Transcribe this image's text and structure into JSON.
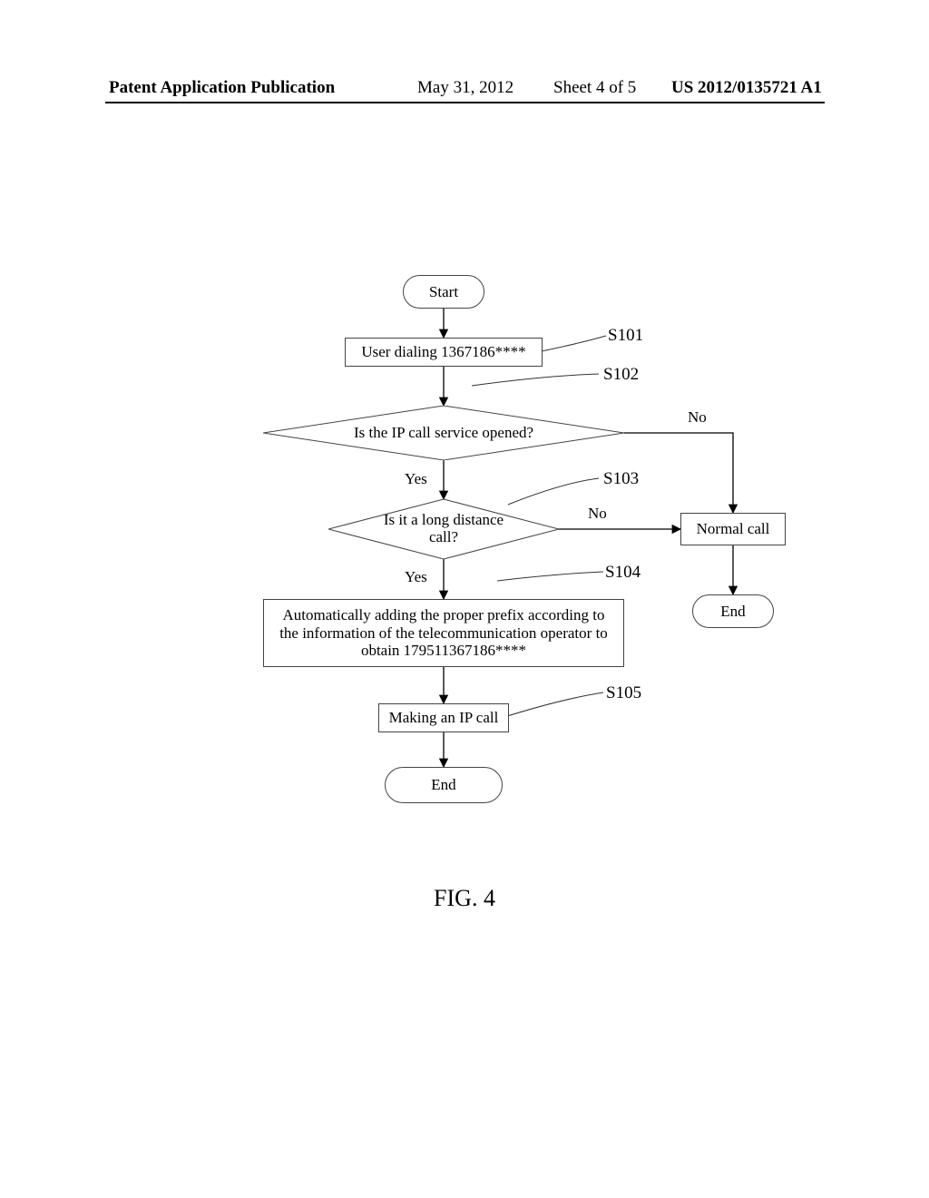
{
  "header": {
    "publication_label": "Patent Application Publication",
    "date": "May 31, 2012",
    "sheet": "Sheet 4 of 5",
    "pub_number": "US 2012/0135721 A1"
  },
  "figure_caption": "FIG. 4",
  "steps": {
    "s101": "S101",
    "s102": "S102",
    "s103": "S103",
    "s104": "S104",
    "s105": "S105"
  },
  "nodes": {
    "start": "Start",
    "user_dialing": "User dialing 1367186****",
    "ip_opened": "Is the IP call service opened?",
    "long_distance": "Is it a long distance\ncall?",
    "add_prefix": "Automatically adding the proper prefix according to the information of the telecommunication operator to obtain 179511367186****",
    "make_ip_call": "Making an IP call",
    "normal_call": "Normal call",
    "end_l": "End",
    "end_r": "End"
  },
  "edges": {
    "yes": "Yes",
    "no": "No"
  },
  "chart_data": {
    "type": "flowchart",
    "title": "FIG. 4",
    "nodes": [
      {
        "id": "start",
        "type": "terminator",
        "label": "Start"
      },
      {
        "id": "user_dialing",
        "type": "process",
        "label": "User dialing 1367186****",
        "step": "S101"
      },
      {
        "id": "ip_opened",
        "type": "decision",
        "label": "Is the IP call service opened?",
        "step": "S102"
      },
      {
        "id": "long_distance",
        "type": "decision",
        "label": "Is it a long distance call?",
        "step": "S103"
      },
      {
        "id": "add_prefix",
        "type": "process",
        "label": "Automatically adding the proper prefix according to the information of the telecommunication operator to obtain 179511367186****",
        "step": "S104"
      },
      {
        "id": "make_ip_call",
        "type": "process",
        "label": "Making an IP call",
        "step": "S105"
      },
      {
        "id": "normal_call",
        "type": "process",
        "label": "Normal call"
      },
      {
        "id": "end_l",
        "type": "terminator",
        "label": "End"
      },
      {
        "id": "end_r",
        "type": "terminator",
        "label": "End"
      }
    ],
    "edges": [
      {
        "from": "start",
        "to": "user_dialing"
      },
      {
        "from": "user_dialing",
        "to": "ip_opened"
      },
      {
        "from": "ip_opened",
        "to": "long_distance",
        "label": "Yes"
      },
      {
        "from": "ip_opened",
        "to": "normal_call",
        "label": "No"
      },
      {
        "from": "long_distance",
        "to": "add_prefix",
        "label": "Yes"
      },
      {
        "from": "long_distance",
        "to": "normal_call",
        "label": "No"
      },
      {
        "from": "add_prefix",
        "to": "make_ip_call"
      },
      {
        "from": "make_ip_call",
        "to": "end_l"
      },
      {
        "from": "normal_call",
        "to": "end_r"
      }
    ]
  }
}
